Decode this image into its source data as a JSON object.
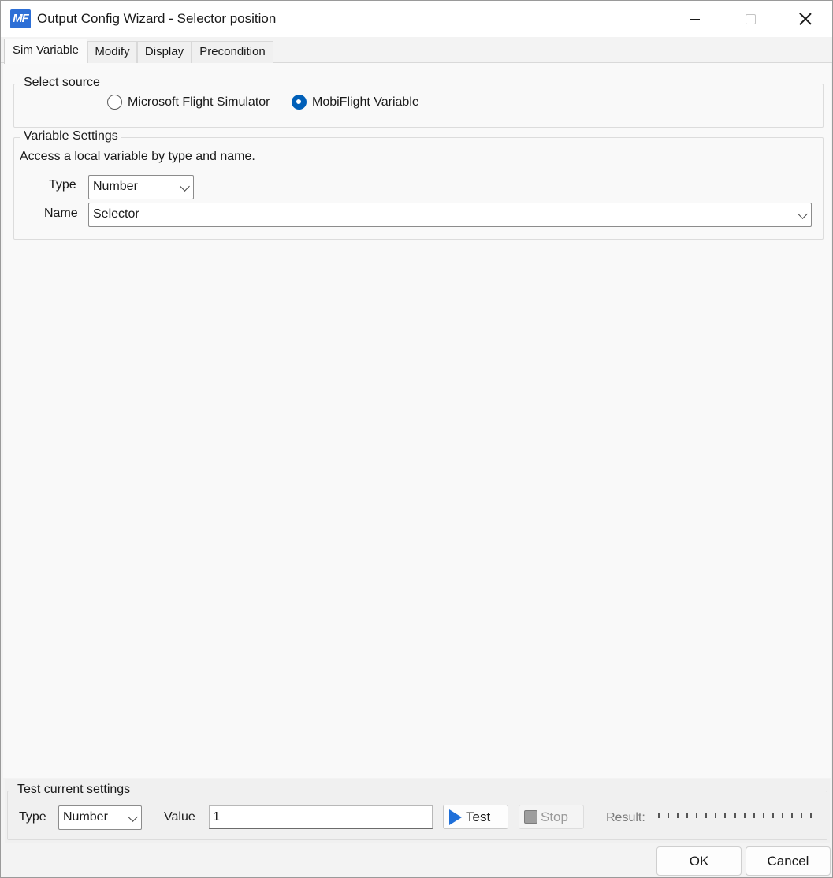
{
  "window": {
    "app_icon_text": "MF",
    "title": "Output Config Wizard - Selector position"
  },
  "tabs": [
    {
      "label": "Sim Variable",
      "active": true
    },
    {
      "label": "Modify",
      "active": false
    },
    {
      "label": "Display",
      "active": false
    },
    {
      "label": "Precondition",
      "active": false
    }
  ],
  "select_source": {
    "legend": "Select source",
    "options": [
      {
        "label": "Microsoft Flight Simulator",
        "checked": false
      },
      {
        "label": "MobiFlight Variable",
        "checked": true
      }
    ]
  },
  "variable_settings": {
    "legend": "Variable Settings",
    "hint": "Access a local variable by type and name.",
    "type_label": "Type",
    "type_value": "Number",
    "name_label": "Name",
    "name_value": "Selector"
  },
  "test_settings": {
    "legend": "Test current settings",
    "type_label": "Type",
    "type_value": "Number",
    "value_label": "Value",
    "value": "1",
    "test_button": "Test",
    "stop_button": "Stop",
    "result_label": "Result:",
    "result_tick_count": 17
  },
  "dialog_buttons": {
    "ok": "OK",
    "cancel": "Cancel"
  },
  "colors": {
    "accent": "#005fb8",
    "app_icon": "#2d6fd6"
  }
}
